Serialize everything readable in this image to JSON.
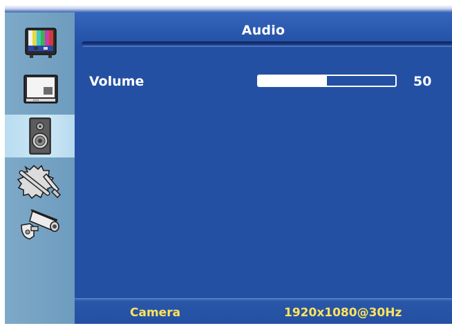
{
  "menu": {
    "title": "Audio",
    "sidebar": [
      {
        "icon": "picture-tv-icon",
        "active": false
      },
      {
        "icon": "display-monitor-icon",
        "active": false
      },
      {
        "icon": "speaker-icon",
        "active": true
      },
      {
        "icon": "tools-setup-icon",
        "active": false
      },
      {
        "icon": "security-camera-icon",
        "active": false
      }
    ]
  },
  "settings": {
    "volume": {
      "label": "Volume",
      "value": "50",
      "level": 0.5
    }
  },
  "status": {
    "source": "Camera",
    "resolution": "1920x1080@30Hz"
  },
  "colors": {
    "panel": "#2450a4",
    "sidebar": "#6e9cbe",
    "active_item": "#cde8f6",
    "status_text": "#ffe45c"
  }
}
